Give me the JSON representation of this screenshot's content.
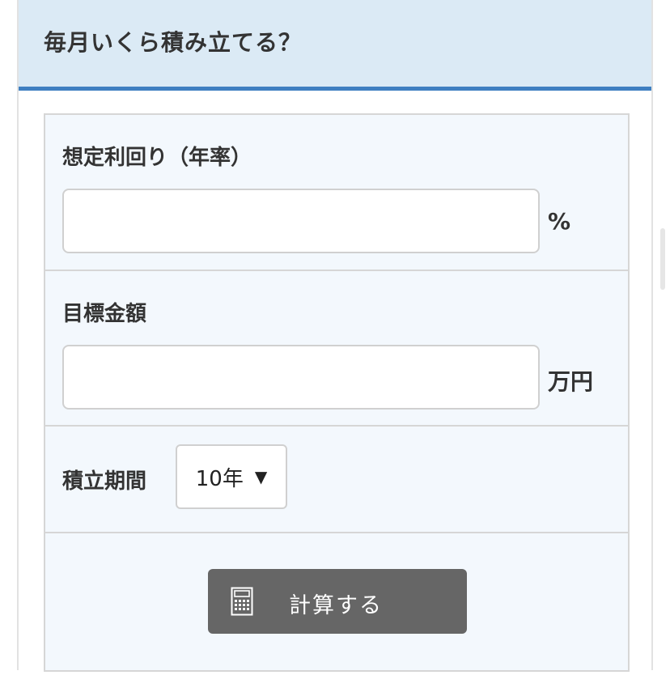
{
  "header": {
    "title": "毎月いくら積み立てる？"
  },
  "form": {
    "rate": {
      "label": "想定利回り（年率）",
      "value": "",
      "placeholder": "",
      "unit": "%"
    },
    "target": {
      "label": "目標金額",
      "value": "",
      "placeholder": "",
      "unit": "万円"
    },
    "period": {
      "label": "積立期間",
      "selected": "10年",
      "arrow": "▼"
    },
    "submit": {
      "label": "計算する",
      "icon": "calculator-icon"
    }
  },
  "colors": {
    "header_bg": "#dbeaf5",
    "header_accent": "#3f7fc1",
    "form_bg": "#f3f8fd",
    "button_bg": "#666666"
  }
}
